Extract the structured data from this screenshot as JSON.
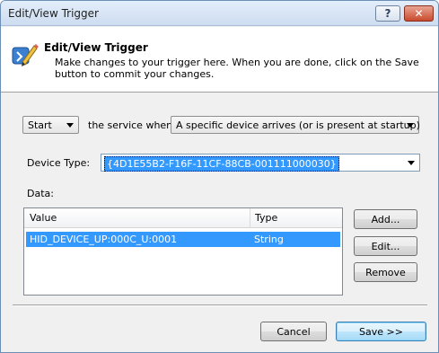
{
  "window": {
    "title": "Edit/View Trigger",
    "help_label": "?",
    "close_label": "✕"
  },
  "header": {
    "title": "Edit/View Trigger",
    "description": "Make changes to your trigger here. When you are done, click on the Save button to commit your changes."
  },
  "trigger": {
    "action_value": "Start",
    "service_when_label": "the service when:",
    "condition_value": "A specific device arrives (or is present at startup)",
    "device_type_label": "Device Type:",
    "device_type_value": "{4D1E55B2-F16F-11CF-88CB-001111000030}",
    "data_label": "Data:"
  },
  "data_list": {
    "columns": [
      "Value",
      "Type"
    ],
    "rows": [
      {
        "value": "HID_DEVICE_UP:000C_U:0001",
        "type": "String",
        "selected": true
      }
    ]
  },
  "side_buttons": {
    "add": "Add...",
    "edit": "Edit...",
    "remove": "Remove"
  },
  "footer": {
    "cancel": "Cancel",
    "save": "Save >>"
  },
  "colors": {
    "selection": "#3399ff",
    "title_bar": "#cddcf0",
    "close_button": "#c94a2e"
  }
}
